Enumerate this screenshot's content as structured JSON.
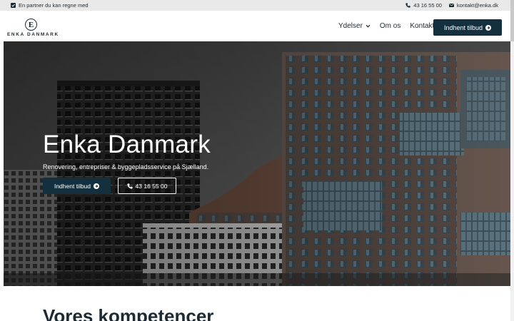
{
  "topbar": {
    "tagline": "En partner du kan regne med",
    "phone": "43 16 55 00",
    "email": "kontakt@enka.dk",
    "icons": [
      "check-square-icon",
      "phone-icon",
      "envelope-icon"
    ]
  },
  "header": {
    "logo_letter": "E",
    "logo_text": "ENKA DANMARK",
    "nav": [
      {
        "label": "Ydelser",
        "has_dropdown": true
      },
      {
        "label": "Om os"
      },
      {
        "label": "Kontakt"
      }
    ],
    "cta_label": "Indhent tilbud"
  },
  "hero": {
    "title": "Enka Danmark",
    "subtitle": "Renovering, entrepriser & byggepladsservice på Sjælland.",
    "primary_button": "Indhent tilbud",
    "secondary_button": "43 16 55 00"
  },
  "main": {
    "section_title": "Vores kompetencer"
  },
  "colors": {
    "brand_dark": "#14303f",
    "topbar_bg": "#e9e9e9",
    "text": "#1d2a33"
  }
}
